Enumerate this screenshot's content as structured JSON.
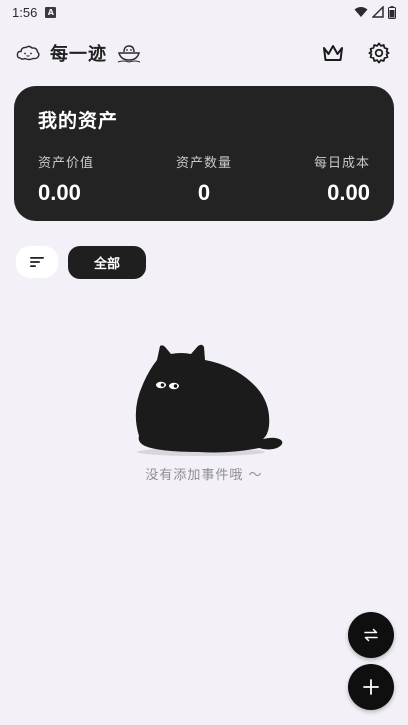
{
  "status_bar": {
    "time": "1:56",
    "notification_icon": "A"
  },
  "header": {
    "title": "每一迹",
    "left_icon": "doodle-cloud-icon",
    "right_logo_icon": "doodle-boat-icon",
    "actions": [
      "crown-icon",
      "gear-icon"
    ]
  },
  "asset_card": {
    "title": "我的资产",
    "stats": [
      {
        "label": "资产价值",
        "value": "0.00"
      },
      {
        "label": "资产数量",
        "value": "0"
      },
      {
        "label": "每日成本",
        "value": "0.00"
      }
    ]
  },
  "filters": {
    "sort_icon": "sort-icon",
    "active_chip": "全部"
  },
  "empty_state": {
    "message": "没有添加事件哦 ～",
    "illustration": "black-cat"
  },
  "fabs": [
    "swap-icon",
    "plus-icon"
  ],
  "colors": {
    "background": "#f3f1f7",
    "card": "#232324",
    "fab": "#0f0f10"
  }
}
